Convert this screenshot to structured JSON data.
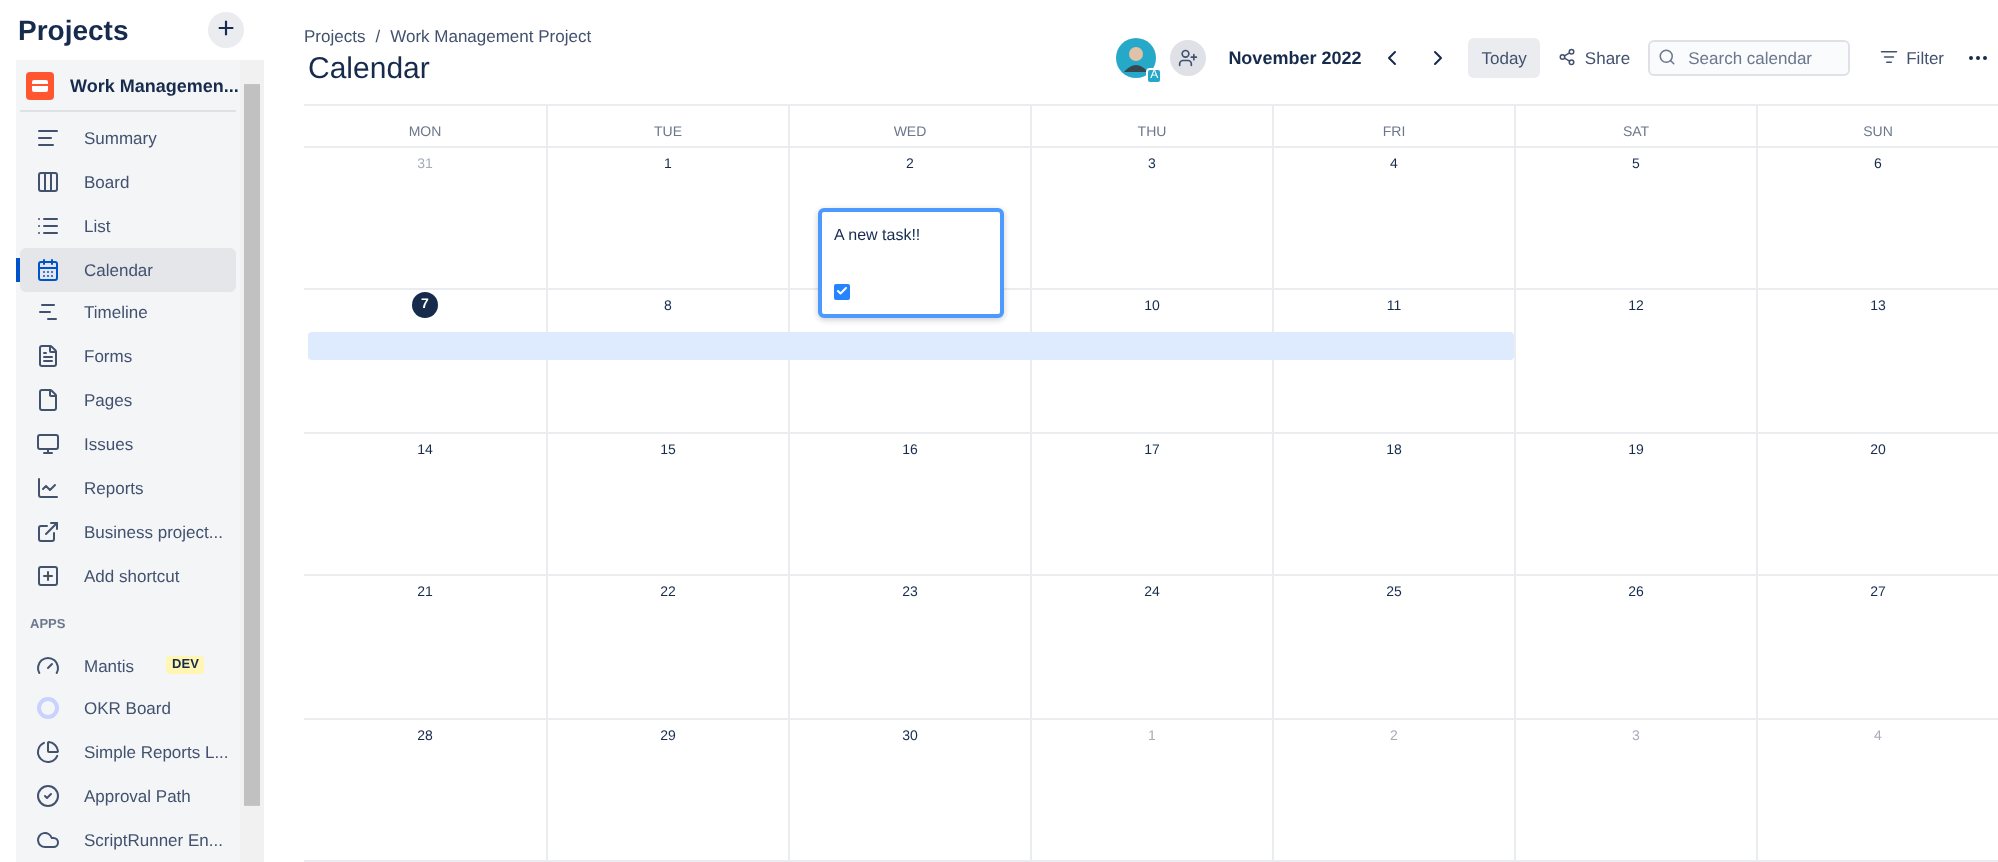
{
  "sidebar": {
    "title": "Projects",
    "add_button": "+",
    "project": {
      "name": "Work Managemen..."
    },
    "items": [
      {
        "label": "Summary",
        "selected": false
      },
      {
        "label": "Board",
        "selected": false
      },
      {
        "label": "List",
        "selected": false
      },
      {
        "label": "Calendar",
        "selected": true
      },
      {
        "label": "Timeline",
        "selected": false
      },
      {
        "label": "Forms",
        "selected": false
      },
      {
        "label": "Pages",
        "selected": false
      },
      {
        "label": "Issues",
        "selected": false
      },
      {
        "label": "Reports",
        "selected": false
      },
      {
        "label": "Business project...",
        "selected": false
      },
      {
        "label": "Add shortcut",
        "selected": false
      }
    ],
    "apps_heading": "APPS",
    "apps": [
      {
        "label": "Mantis",
        "badge": "DEV"
      },
      {
        "label": "OKR Board"
      },
      {
        "label": "Simple Reports L..."
      },
      {
        "label": "Approval Path"
      },
      {
        "label": "ScriptRunner En..."
      }
    ]
  },
  "breadcrumbs": [
    "Projects",
    "Work Management Project"
  ],
  "breadcrumb_separator": "/",
  "title": "Calendar",
  "toolbar": {
    "avatar_badge": "A",
    "month": "November 2022",
    "today": "Today",
    "share": "Share",
    "search": {
      "placeholder": "Search calendar"
    },
    "filter": "Filter"
  },
  "weekdays": [
    "MON",
    "TUE",
    "WED",
    "THU",
    "FRI",
    "SAT",
    "SUN"
  ],
  "weeks": [
    {
      "days": [
        {
          "label": "31",
          "muted": true
        },
        {
          "label": "1",
          "muted": false
        },
        {
          "label": "2",
          "muted": false,
          "task": {
            "title": "A new task!!",
            "done": true
          }
        },
        {
          "label": "3",
          "muted": false
        },
        {
          "label": "4",
          "muted": false
        },
        {
          "label": "5",
          "muted": false
        },
        {
          "label": "6",
          "muted": false
        }
      ]
    },
    {
      "days": [
        {
          "label": "7",
          "today": true,
          "in_event": true
        },
        {
          "label": "8",
          "muted": false,
          "in_event": true
        },
        {
          "in_event": true
        },
        {
          "label": "10",
          "muted": false,
          "in_event": true
        },
        {
          "label": "11",
          "muted": false,
          "in_event": true
        },
        {
          "label": "12",
          "muted": false
        },
        {
          "label": "13",
          "muted": false
        }
      ]
    },
    {
      "days": [
        {
          "label": "14",
          "muted": false
        },
        {
          "label": "15",
          "muted": false
        },
        {
          "label": "16",
          "muted": false
        },
        {
          "label": "17",
          "muted": false
        },
        {
          "label": "18",
          "muted": false
        },
        {
          "label": "19",
          "muted": false
        },
        {
          "label": "20",
          "muted": false
        }
      ]
    },
    {
      "days": [
        {
          "label": "21",
          "muted": false
        },
        {
          "label": "22",
          "muted": false
        },
        {
          "label": "23",
          "muted": false
        },
        {
          "label": "24",
          "muted": false
        },
        {
          "label": "25",
          "muted": false
        },
        {
          "label": "26",
          "muted": false
        },
        {
          "label": "27",
          "muted": false
        }
      ]
    },
    {
      "days": [
        {
          "label": "28",
          "muted": false
        },
        {
          "label": "29",
          "muted": false
        },
        {
          "label": "30",
          "muted": false
        },
        {
          "label": "1",
          "muted": true
        },
        {
          "label": "2",
          "muted": true
        },
        {
          "label": "3",
          "muted": true
        },
        {
          "label": "4",
          "muted": true
        }
      ]
    }
  ]
}
